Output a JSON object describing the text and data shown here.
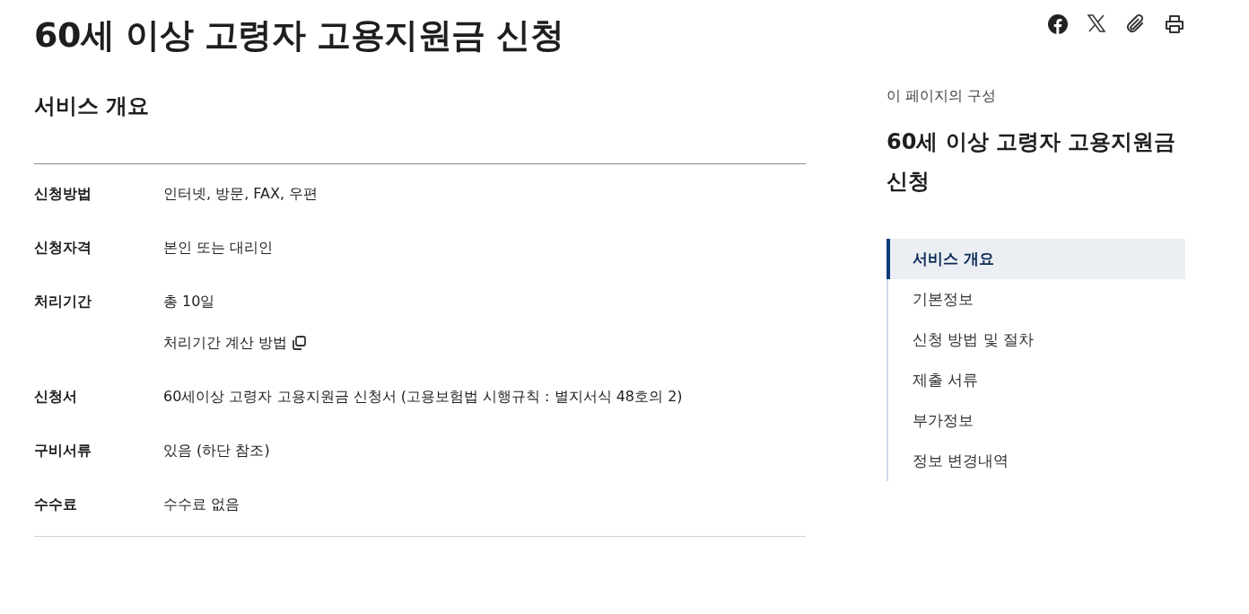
{
  "page_title": "60세 이상 고령자 고용지원금 신청",
  "section_title": "서비스 개요",
  "rows": [
    {
      "label": "신청방법",
      "value": "인터넷, 방문, FAX, 우편"
    },
    {
      "label": "신청자격",
      "value": "본인 또는 대리인"
    },
    {
      "label": "처리기간",
      "value": "총 10일",
      "link": "처리기간 계산 방법"
    },
    {
      "label": "신청서",
      "value": "60세이상 고령자 고용지원금 신청서 (고용보험법 시행규칙 : 별지서식 48호의 2)"
    },
    {
      "label": "구비서류",
      "value": "있음 (하단 참조)"
    },
    {
      "label": "수수료",
      "value": "수수료 없음"
    }
  ],
  "toc": {
    "caption": "이 페이지의 구성",
    "title": "60세 이상 고령자 고용지원금 신청",
    "items": [
      {
        "label": "서비스 개요",
        "selected": true
      },
      {
        "label": "기본정보",
        "selected": false
      },
      {
        "label": "신청 방법 및 절차",
        "selected": false
      },
      {
        "label": "제출 서류",
        "selected": false
      },
      {
        "label": "부가정보",
        "selected": false
      },
      {
        "label": "정보 변경내역",
        "selected": false
      }
    ]
  }
}
